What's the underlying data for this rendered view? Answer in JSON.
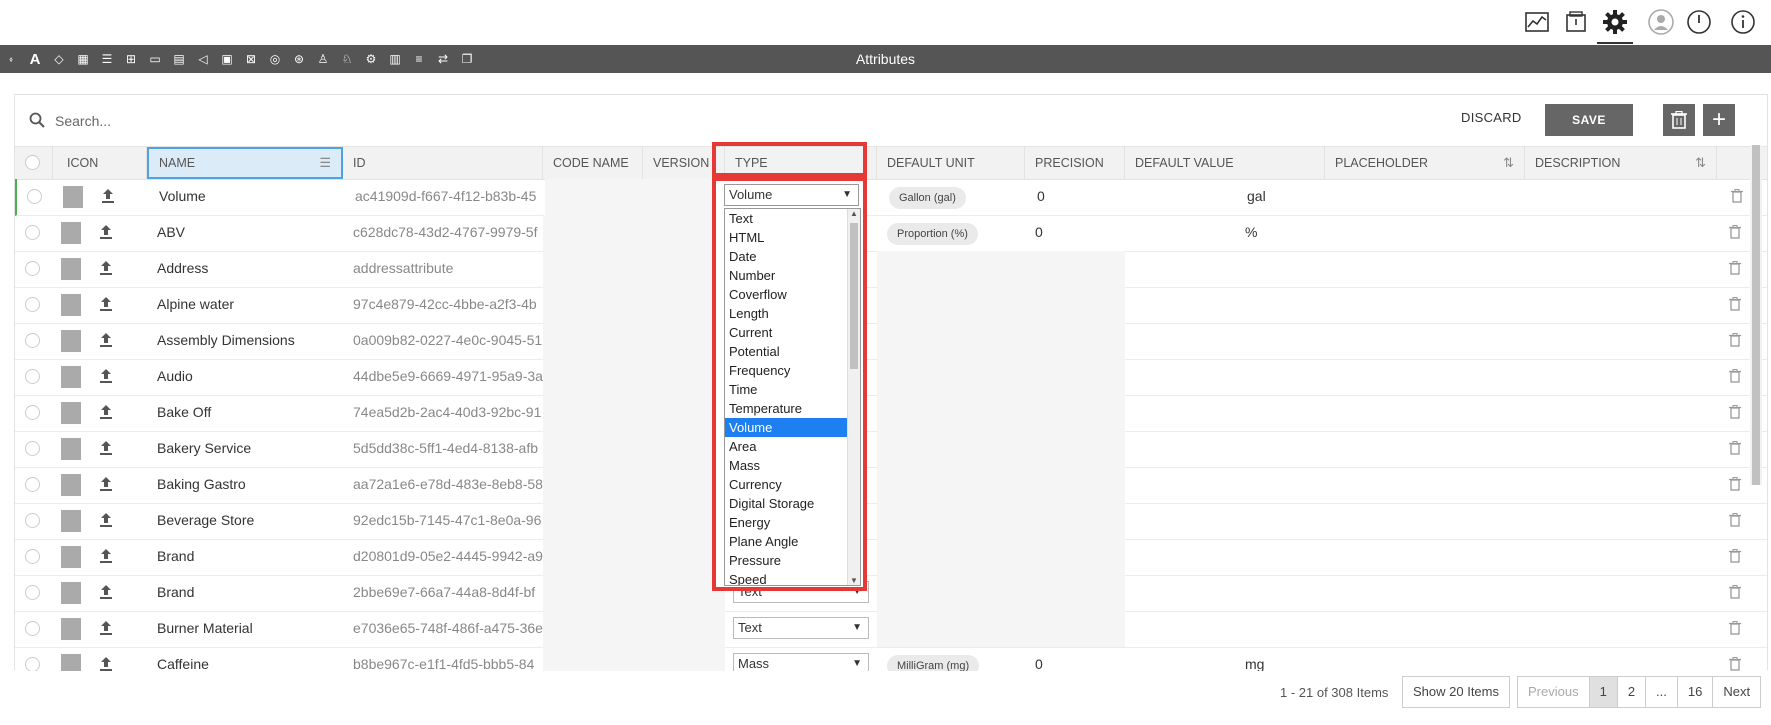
{
  "toolbar": {
    "title": "Attributes",
    "tools": [
      "tag-icon",
      "text-a-icon",
      "label-icon",
      "calendar-icon",
      "checklist-icon",
      "table-icon",
      "card-icon",
      "form-icon",
      "tag-plus-icon",
      "grid-icon",
      "dashboard-icon",
      "check-circle-icon",
      "network-icon",
      "user-icon",
      "user-add-icon",
      "settings-group-icon",
      "book-icon",
      "list-icon",
      "transfer-icon",
      "copy-icon"
    ]
  },
  "topnav": {
    "icons": [
      "analytics-icon",
      "package-icon",
      "gear-icon",
      "avatar-icon",
      "power-icon",
      "info-icon"
    ]
  },
  "search": {
    "placeholder": "Search..."
  },
  "actions": {
    "discard_label": "DISCARD",
    "save_label": "SAVE"
  },
  "columns": {
    "icon": "ICON",
    "name": "NAME",
    "id": "ID",
    "code_name": "CODE NAME",
    "version": "VERSION",
    "type": "TYPE",
    "default_unit": "DEFAULT UNIT",
    "precision": "PRECISION",
    "default_value": "DEFAULT VALUE",
    "placeholder": "PLACEHOLDER",
    "description": "DESCRIPTION"
  },
  "rows": [
    {
      "name": "Volume",
      "id": "ac41909d-f667-4f12-b83b-45",
      "type": "Volume",
      "unit": "Gallon (gal)",
      "precision": "0",
      "default_value": "gal"
    },
    {
      "name": "ABV",
      "id": "c628dc78-43d2-4767-9979-5f",
      "type": "",
      "unit": "Proportion (%)",
      "precision": "0",
      "default_value": "%"
    },
    {
      "name": "Address",
      "id": "addressattribute",
      "type": "",
      "unit": "",
      "precision": "",
      "default_value": ""
    },
    {
      "name": "Alpine water",
      "id": "97c4e879-42cc-4bbe-a2f3-4b",
      "type": "",
      "unit": "",
      "precision": "",
      "default_value": ""
    },
    {
      "name": "Assembly Dimensions",
      "id": "0a009b82-0227-4e0c-9045-51",
      "type": "",
      "unit": "",
      "precision": "",
      "default_value": ""
    },
    {
      "name": "Audio",
      "id": "44dbe5e9-6669-4971-95a9-3a",
      "type": "",
      "unit": "",
      "precision": "",
      "default_value": ""
    },
    {
      "name": "Bake Off",
      "id": "74ea5d2b-2ac4-40d3-92bc-91",
      "type": "",
      "unit": "",
      "precision": "",
      "default_value": ""
    },
    {
      "name": "Bakery Service",
      "id": "5d5dd38c-5ff1-4ed4-8138-afb",
      "type": "",
      "unit": "",
      "precision": "",
      "default_value": ""
    },
    {
      "name": "Baking Gastro",
      "id": "aa72a1e6-e78d-483e-8eb8-58",
      "type": "",
      "unit": "",
      "precision": "",
      "default_value": ""
    },
    {
      "name": "Beverage Store",
      "id": "92edc15b-7145-47c1-8e0a-96",
      "type": "",
      "unit": "",
      "precision": "",
      "default_value": ""
    },
    {
      "name": "Brand",
      "id": "d20801d9-05e2-4445-9942-a9",
      "type": "",
      "unit": "",
      "precision": "",
      "default_value": ""
    },
    {
      "name": "Brand",
      "id": "2bbe69e7-66a7-44a8-8d4f-bf",
      "type": "Text",
      "unit": "",
      "precision": "",
      "default_value": ""
    },
    {
      "name": "Burner Material",
      "id": "e7036e65-748f-486f-a475-36e",
      "type": "Text",
      "unit": "",
      "precision": "",
      "default_value": ""
    },
    {
      "name": "Caffeine",
      "id": "b8be967c-e1f1-4fd5-bbb5-84",
      "type": "Mass",
      "unit": "MilliGram (mg)",
      "precision": "0",
      "default_value": "mg"
    }
  ],
  "dropdown": {
    "value": "Volume",
    "selected": "Volume",
    "options": [
      "Text",
      "HTML",
      "Date",
      "Number",
      "Coverflow",
      "Length",
      "Current",
      "Potential",
      "Frequency",
      "Time",
      "Temperature",
      "Volume",
      "Area",
      "Mass",
      "Currency",
      "Digital Storage",
      "Energy",
      "Plane Angle",
      "Pressure",
      "Speed"
    ]
  },
  "footer": {
    "count": "1 - 21 of 308 Items",
    "show_label": "Show 20 Items",
    "pages": [
      "Previous",
      "1",
      "2",
      "...",
      "16",
      "Next"
    ]
  },
  "colors": {
    "accent": "#4da3e0",
    "highlight": "#e53935",
    "selected": "#1e7ff0",
    "button": "#666666"
  }
}
